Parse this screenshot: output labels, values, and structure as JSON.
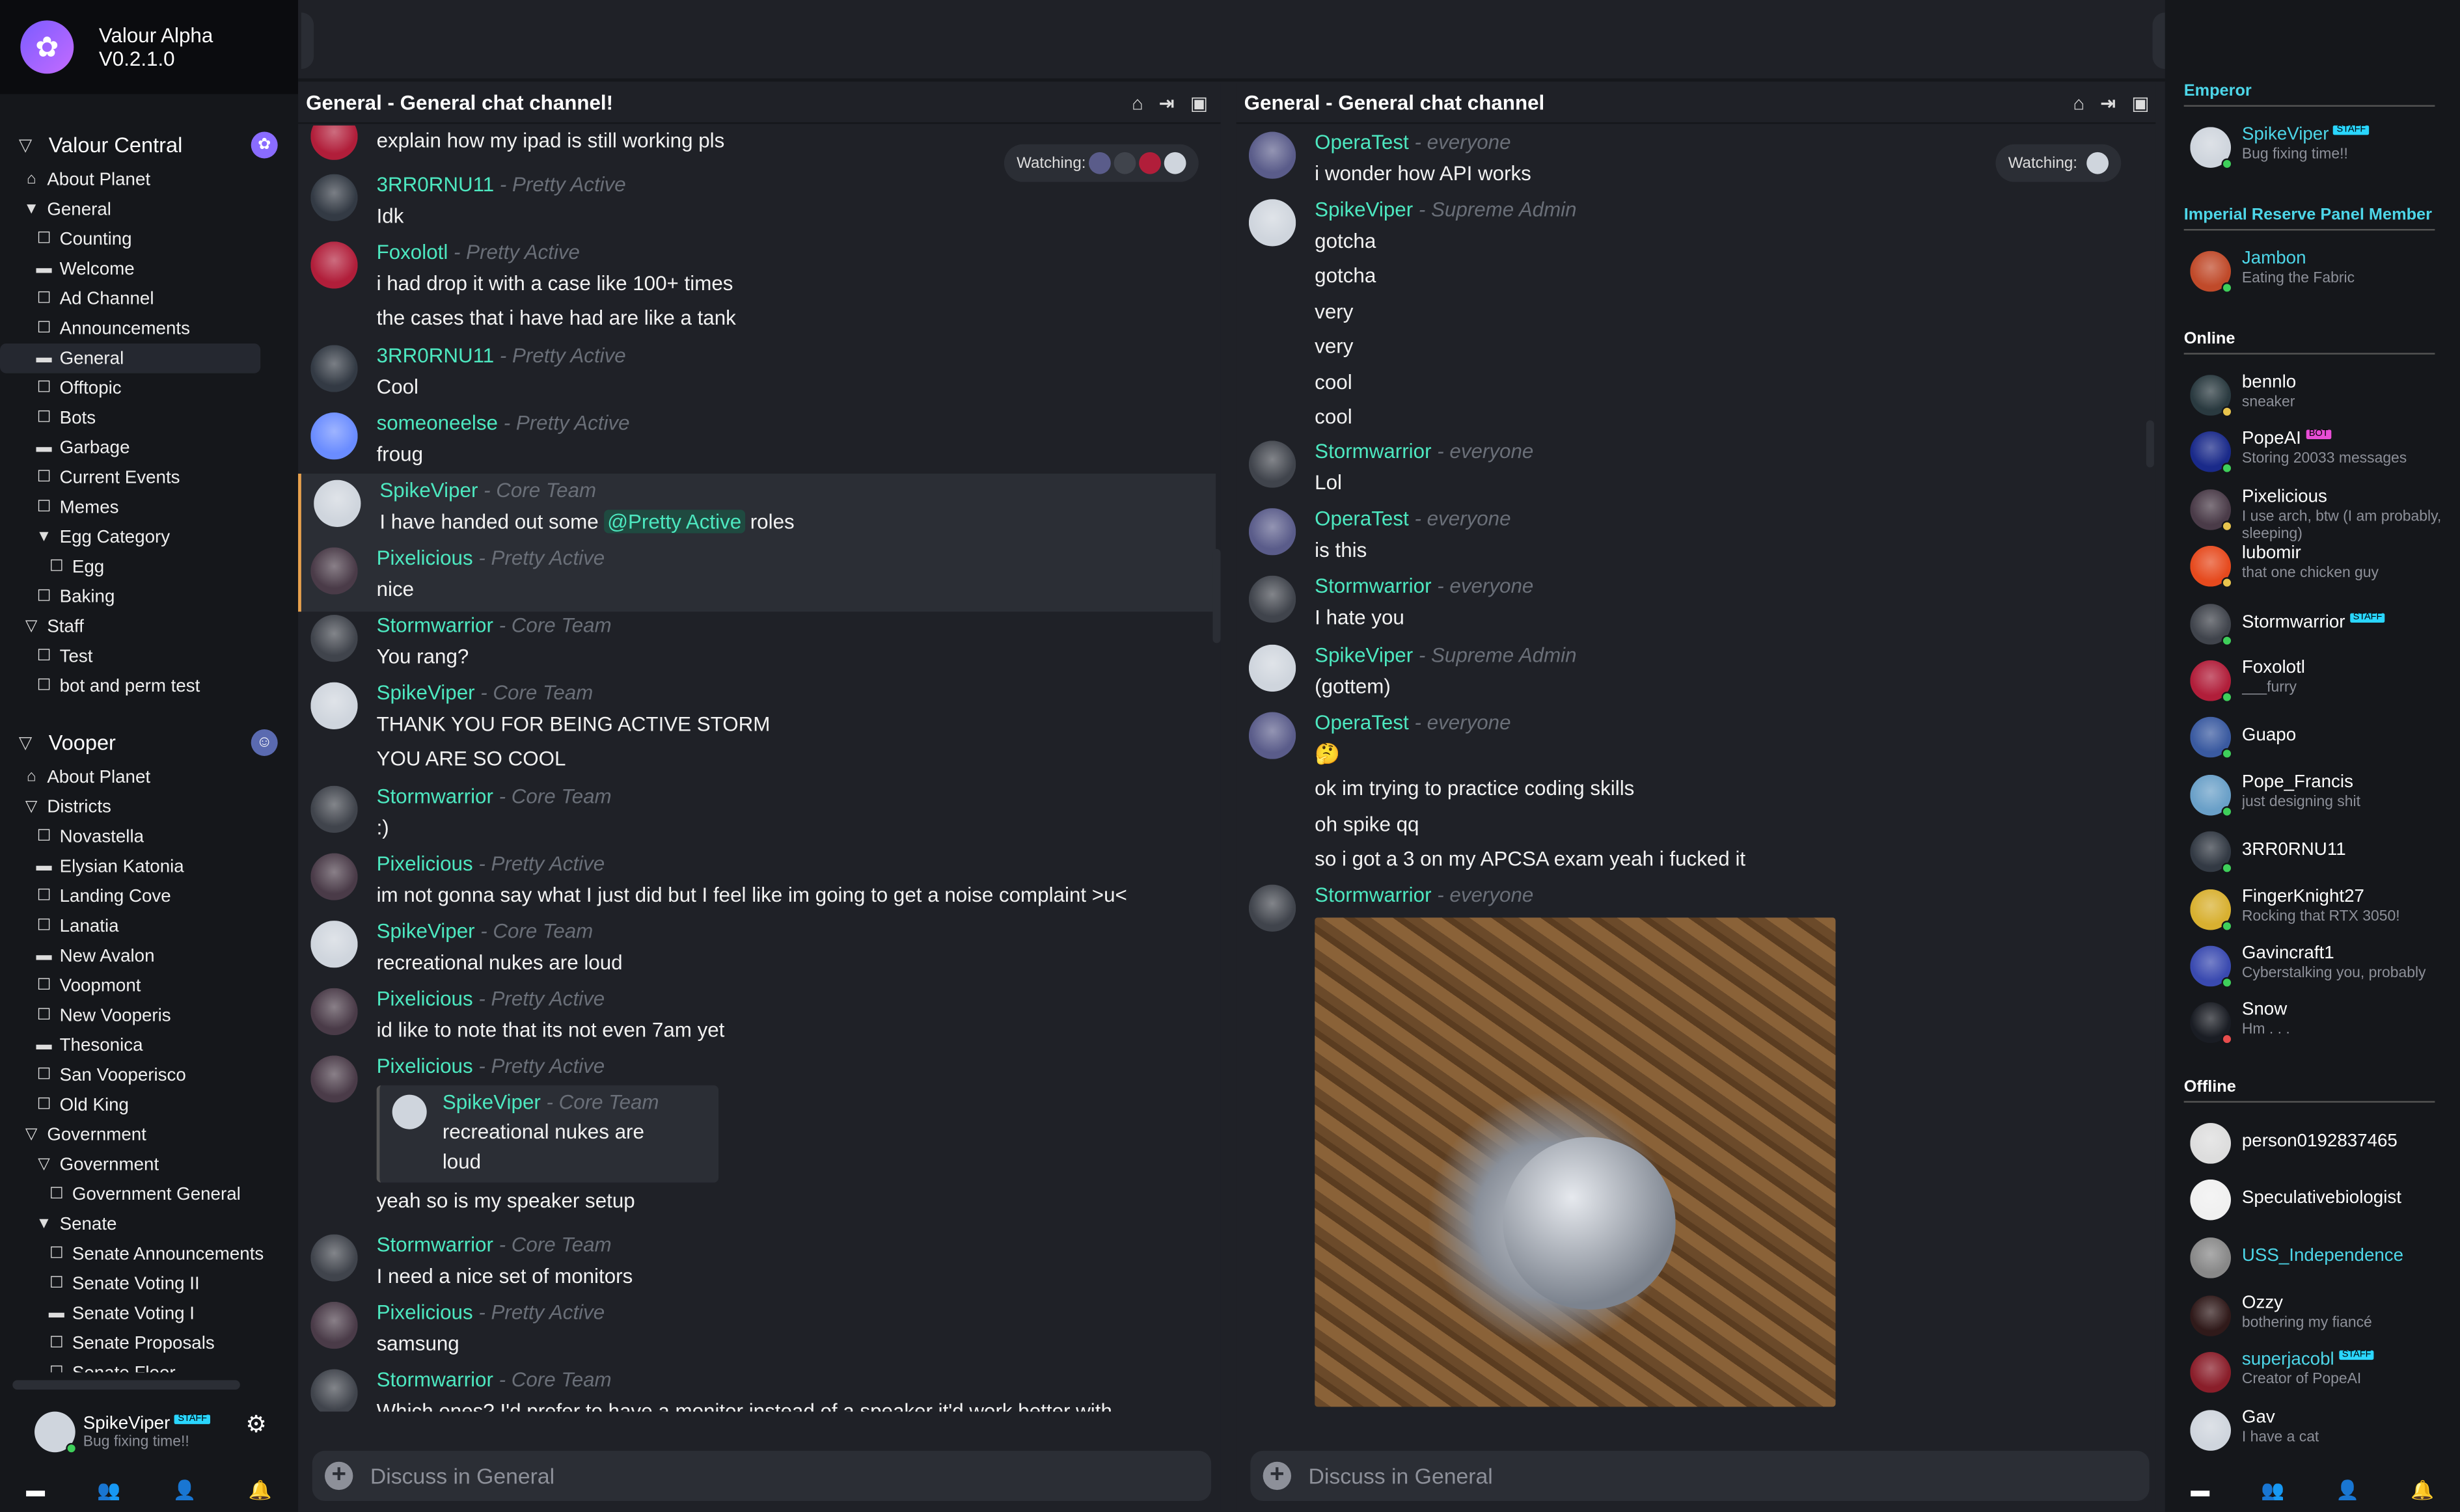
{
  "app": {
    "name": "Valour Alpha",
    "version": "V0.2.1.0"
  },
  "left": {
    "planets": [
      {
        "name": "Valour Central",
        "items": [
          {
            "t": "p",
            "l": "About Planet",
            "d": 0
          },
          {
            "t": "cat",
            "l": "General",
            "d": 0,
            "open": true
          },
          {
            "t": "ch",
            "l": "Counting",
            "d": 1
          },
          {
            "t": "ch",
            "l": "Welcome",
            "d": 1
          },
          {
            "t": "ch",
            "l": "Ad Channel",
            "d": 1
          },
          {
            "t": "ch",
            "l": "Announcements",
            "d": 1
          },
          {
            "t": "ch",
            "l": "General",
            "d": 1,
            "sel": true
          },
          {
            "t": "ch",
            "l": "Offtopic",
            "d": 1
          },
          {
            "t": "ch",
            "l": "Bots",
            "d": 1
          },
          {
            "t": "ch",
            "l": "Garbage",
            "d": 1
          },
          {
            "t": "ch",
            "l": "Current Events",
            "d": 1
          },
          {
            "t": "ch",
            "l": "Memes",
            "d": 1
          },
          {
            "t": "cat",
            "l": "Egg Category",
            "d": 1,
            "open": true
          },
          {
            "t": "ch",
            "l": "Egg",
            "d": 2
          },
          {
            "t": "ch",
            "l": "Baking",
            "d": 1
          },
          {
            "t": "cat",
            "l": "Staff",
            "d": 0,
            "open": false
          },
          {
            "t": "ch",
            "l": "Test",
            "d": 1
          },
          {
            "t": "ch",
            "l": "bot and perm test",
            "d": 1
          }
        ]
      },
      {
        "name": "Vooper",
        "items": [
          {
            "t": "p",
            "l": "About Planet",
            "d": 0
          },
          {
            "t": "cat",
            "l": "Districts",
            "d": 0,
            "open": false
          },
          {
            "t": "ch",
            "l": "Novastella",
            "d": 1
          },
          {
            "t": "ch",
            "l": "Elysian Katonia",
            "d": 1
          },
          {
            "t": "ch",
            "l": "Landing Cove",
            "d": 1
          },
          {
            "t": "ch",
            "l": "Lanatia",
            "d": 1
          },
          {
            "t": "ch",
            "l": "New Avalon",
            "d": 1
          },
          {
            "t": "ch",
            "l": "Voopmont",
            "d": 1
          },
          {
            "t": "ch",
            "l": "New Vooperis",
            "d": 1
          },
          {
            "t": "ch",
            "l": "Thesonica",
            "d": 1
          },
          {
            "t": "ch",
            "l": "San Vooperisco",
            "d": 1
          },
          {
            "t": "ch",
            "l": "Old King",
            "d": 1
          },
          {
            "t": "cat",
            "l": "Government",
            "d": 0,
            "open": false
          },
          {
            "t": "cat",
            "l": "Government",
            "d": 1,
            "open": false
          },
          {
            "t": "ch",
            "l": "Government General",
            "d": 2
          },
          {
            "t": "cat",
            "l": "Senate",
            "d": 1,
            "open": true
          },
          {
            "t": "ch",
            "l": "Senate Announcements",
            "d": 2
          },
          {
            "t": "ch",
            "l": "Senate Voting II",
            "d": 2
          },
          {
            "t": "ch",
            "l": "Senate Voting I",
            "d": 2
          },
          {
            "t": "ch",
            "l": "Senate Proposals",
            "d": 2
          },
          {
            "t": "ch",
            "l": "Senate Floor",
            "d": 2
          }
        ]
      }
    ],
    "user": {
      "name": "SpikeViper",
      "badge": "STAFF",
      "status": "Bug fixing time!!"
    }
  },
  "chan1": {
    "title": "General - General chat channel!",
    "watching": "Watching:",
    "input_placeholder": "Discuss in General",
    "messages": [
      {
        "name": "",
        "role": "",
        "lines": [
          "explain how my ipad is still working pls"
        ],
        "av": "#b11e3a"
      },
      {
        "name": "3RR0RNU11",
        "role": " - Pretty Active",
        "lines": [
          "Idk"
        ],
        "av": "#333a44"
      },
      {
        "name": "Foxolotl",
        "role": " - Pretty Active",
        "lines": [
          "i had drop it with a case like 100+ times",
          "the cases that i have had are like a tank"
        ],
        "av": "#b11e3a"
      },
      {
        "name": "3RR0RNU11",
        "role": " - Pretty Active",
        "lines": [
          "Cool"
        ],
        "av": "#333a44"
      },
      {
        "name": "someoneelse",
        "role": " - Pretty Active",
        "lines": [
          "froug"
        ],
        "av": "#6a8cff"
      },
      {
        "name": "SpikeViper",
        "role": " - Core Team",
        "lines": [
          "I have handed out some ",
          "@Pretty Active",
          " roles"
        ],
        "av": "#cfd5dd",
        "hl": true
      },
      {
        "name": "Pixelicious",
        "role": " - Pretty Active",
        "lines": [
          "nice"
        ],
        "av": "#4a3b48"
      },
      {
        "name": "Stormwarrior",
        "role": " - Core Team",
        "lines": [
          "You rang?"
        ],
        "av": "#40444c"
      },
      {
        "name": "SpikeViper",
        "role": " - Core Team",
        "lines": [
          "THANK YOU FOR BEING ACTIVE STORM",
          "YOU ARE SO COOL"
        ],
        "av": "#cfd5dd"
      },
      {
        "name": "Stormwarrior",
        "role": " - Core Team",
        "lines": [
          ":)"
        ],
        "av": "#40444c"
      },
      {
        "name": "Pixelicious",
        "role": " - Pretty Active",
        "lines": [
          "im not gonna say what I just did but I feel like im going to get a noise complaint >u<"
        ],
        "av": "#4a3b48"
      },
      {
        "name": "SpikeViper",
        "role": " - Core Team",
        "lines": [
          "recreational nukes are loud"
        ],
        "av": "#cfd5dd"
      },
      {
        "name": "Pixelicious",
        "role": " - Pretty Active",
        "lines": [
          "id like to note that its not even 7am yet"
        ],
        "av": "#4a3b48"
      },
      {
        "name": "Pixelicious",
        "role": " - Pretty Active",
        "lines": [
          "yeah so is my speaker setup"
        ],
        "av": "#4a3b48",
        "reply": {
          "name": "SpikeViper",
          "role": " - Core Team",
          "l1": "recreational nukes are",
          "l2": "loud"
        }
      },
      {
        "name": "Stormwarrior",
        "role": " - Core Team",
        "lines": [
          "I need a nice set of monitors"
        ],
        "av": "#40444c"
      },
      {
        "name": "Pixelicious",
        "role": " - Pretty Active",
        "lines": [
          "samsung"
        ],
        "av": "#4a3b48"
      },
      {
        "name": "Stormwarrior",
        "role": " - Core Team",
        "lines": [
          "Which ones? I'd prefer to have a monitor instead of a speaker it'd work better with"
        ],
        "av": "#40444c"
      }
    ]
  },
  "chan2": {
    "title": "General - General chat channel",
    "watching": "Watching:",
    "input_placeholder": "Discuss in General",
    "messages": [
      {
        "name": "OperaTest",
        "role": " - everyone",
        "lines": [
          "i wonder how API works"
        ],
        "av": "#5a5c8a"
      },
      {
        "name": "SpikeViper",
        "role": " - Supreme Admin",
        "lines": [
          "gotcha",
          "gotcha",
          "very",
          "very",
          "cool",
          "cool"
        ],
        "av": "#cfd5dd"
      },
      {
        "name": "Stormwarrior",
        "role": " - everyone",
        "lines": [
          "Lol"
        ],
        "av": "#40444c"
      },
      {
        "name": "OperaTest",
        "role": " - everyone",
        "lines": [
          "is this"
        ],
        "av": "#5a5c8a"
      },
      {
        "name": "Stormwarrior",
        "role": " - everyone",
        "lines": [
          "I hate you"
        ],
        "av": "#40444c"
      },
      {
        "name": "SpikeViper",
        "role": " - Supreme Admin",
        "lines": [
          "(gottem)"
        ],
        "av": "#cfd5dd"
      },
      {
        "name": "OperaTest",
        "role": " - everyone",
        "lines": [
          "🤔",
          "ok im trying to practice coding skills",
          "oh spike qq",
          "so i got a 3 on my APCSA exam yeah i fucked it"
        ],
        "av": "#5a5c8a"
      },
      {
        "name": "Stormwarrior",
        "role": " - everyone",
        "lines": [],
        "av": "#40444c",
        "image": true
      }
    ]
  },
  "members": {
    "groups": [
      {
        "label": "Emperor",
        "color": "#4dd6e8",
        "members": [
          {
            "name": "SpikeViper",
            "badge": "STAFF",
            "status": "Bug fixing time!!",
            "nameColor": "#4dd6e8"
          }
        ]
      },
      {
        "label": "Imperial Reserve Panel Member",
        "color": "#4dd6e8",
        "members": [
          {
            "name": "Jambon",
            "status": "Eating the Fabric",
            "nameColor": "#4dd6e8"
          }
        ]
      },
      {
        "label": "Online",
        "color": "#ffffff",
        "members": [
          {
            "name": "bennlo",
            "status": "sneaker"
          },
          {
            "name": "PopeAI",
            "badge": "BOT",
            "status": "Storing 20033 messages"
          },
          {
            "name": "Pixelicious",
            "status": "I use arch, btw (I am probably, sleeping)"
          },
          {
            "name": "lubomir",
            "status": "that one chicken guy"
          },
          {
            "name": "Stormwarrior",
            "badge": "STAFF",
            "status": ""
          },
          {
            "name": "Foxolotl",
            "status": "___furry"
          },
          {
            "name": "Guapo",
            "status": ""
          },
          {
            "name": "Pope_Francis",
            "status": "just designing shit"
          },
          {
            "name": "3RR0RNU11",
            "status": ""
          },
          {
            "name": "FingerKnight27",
            "status": "Rocking that RTX 3050!"
          },
          {
            "name": "Gavincraft1",
            "status": "Cyberstalking you, probably"
          },
          {
            "name": "Snow",
            "status": "Hm . . ."
          }
        ]
      },
      {
        "label": "Offline",
        "color": "#ffffff",
        "members": [
          {
            "name": "person0192837465",
            "status": ""
          },
          {
            "name": "Speculativebiologist",
            "status": ""
          },
          {
            "name": "USS_Independence",
            "status": "",
            "nameColor": "#4dd6e8"
          },
          {
            "name": "Ozzy",
            "status": "bothering my fiancé"
          },
          {
            "name": "superjacobl",
            "badge": "STAFF",
            "status": "Creator of PopeAI",
            "nameColor": "#4dd6e8"
          },
          {
            "name": "Gav",
            "status": "I have a cat"
          }
        ]
      }
    ]
  },
  "colors": {
    "accent": "#4de8c0",
    "bg": "#1f2127",
    "panel": "#15171b"
  }
}
